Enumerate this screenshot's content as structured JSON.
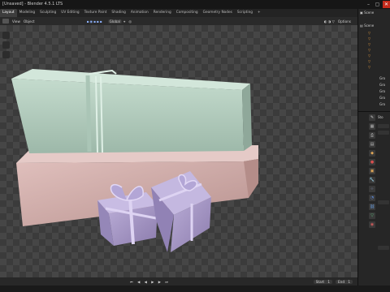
{
  "window": {
    "title": "[Unsaved] - Blender 4.5.1 LTS",
    "buttons": {
      "minimize": "–",
      "maximize": "▢",
      "close": "✕"
    }
  },
  "workspaces": [
    "Layout",
    "Modeling",
    "Sculpting",
    "UV Editing",
    "Texture Paint",
    "Shading",
    "Animation",
    "Rendering",
    "Compositing",
    "Geometry Nodes",
    "Scripting",
    "+"
  ],
  "active_workspace": "Layout",
  "viewport_header": {
    "view_label": "View",
    "object_label": "Object",
    "transform_label": "Global",
    "options_label": "Options"
  },
  "outliner": {
    "scene_label": "Scene",
    "scene_collection_label": "Scene",
    "rows": [
      "",
      "",
      "",
      "",
      "",
      "",
      "",
      "Gro",
      "Gro",
      "Gro",
      "Gro",
      "Gro"
    ]
  },
  "properties": {
    "tabs": [
      "tool-icon",
      "render-icon",
      "output-icon",
      "view-layer-icon",
      "scene-icon",
      "world-icon",
      "object-icon",
      "modifier-icon",
      "particles-icon",
      "physics-icon",
      "constraints-icon",
      "data-icon",
      "material-icon"
    ],
    "section_label": "Sto"
  },
  "timeline": {
    "start_label": "Start",
    "start_value": "1",
    "end_label": "End",
    "end_value": "1"
  },
  "colors": {
    "accent": "#4772b3",
    "mint_box": "#b6cfc1",
    "pink_box": "#d6b3b1",
    "purple_box": "#a99bc8"
  }
}
